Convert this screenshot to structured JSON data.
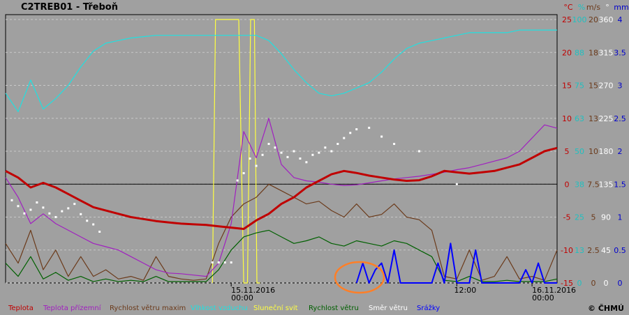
{
  "chart_data": {
    "type": "line",
    "title": "C2TREB01 - Třeboň",
    "copyright": "© ČHMÚ",
    "x_range_hours": [
      -36,
      52
    ],
    "x_ticks": [
      {
        "h": 0,
        "lines": [
          "15.11.2016",
          "00:00"
        ]
      },
      {
        "h": 36,
        "lines": [
          "12:00"
        ]
      },
      {
        "h": 48,
        "lines": [
          "16.11.2016",
          "00:00"
        ]
      }
    ],
    "axes": [
      {
        "unit": "°C",
        "color": "#c00000",
        "ticks": [
          "25",
          "20",
          "15",
          "10",
          "5",
          "0",
          "-5",
          "-10",
          "-15"
        ]
      },
      {
        "unit": "%",
        "color": "#20c0c0",
        "ticks": [
          "100",
          "88",
          "75",
          "63",
          "50",
          "38",
          "25",
          "13",
          "0"
        ]
      },
      {
        "unit": "m/s",
        "color": "#6b3a1a",
        "ticks": [
          "20",
          "18",
          "15",
          "13",
          "10",
          "7.5",
          "5",
          "2.5",
          "0"
        ]
      },
      {
        "unit": "°",
        "color": "#ffffff",
        "ticks": [
          "360",
          "315",
          "270",
          "225",
          "180",
          "135",
          "90",
          "45",
          "0"
        ]
      },
      {
        "unit": "mm",
        "color": "#0000cc",
        "ticks": [
          "4",
          "3.5",
          "3",
          "2.5",
          "2",
          "1.5",
          "1",
          "0.5",
          "0"
        ]
      }
    ],
    "series": [
      {
        "name": "Teplota",
        "color": "#c00000",
        "axis": "°C",
        "x": [
          -36,
          -34,
          -32,
          -30,
          -28,
          -26,
          -24,
          -22,
          -20,
          -18,
          -16,
          -14,
          -12,
          -10,
          -8,
          -6,
          -4,
          -2,
          0,
          2,
          4,
          6,
          8,
          10,
          12,
          14,
          16,
          18,
          20,
          22,
          24,
          26,
          28,
          30,
          32,
          34,
          36,
          38,
          40,
          42,
          44,
          46,
          48,
          50,
          52
        ],
        "y": [
          2,
          1,
          -0.5,
          0.2,
          -0.5,
          -1.5,
          -2.5,
          -3.5,
          -4,
          -4.5,
          -5,
          -5.3,
          -5.6,
          -5.8,
          -6,
          -6.1,
          -6.2,
          -6.4,
          -6.6,
          -6.8,
          -5.5,
          -4.5,
          -3,
          -2,
          -0.5,
          0.5,
          1.5,
          2,
          1.7,
          1.3,
          1,
          0.7,
          0.5,
          0.6,
          1.2,
          2,
          1.8,
          1.6,
          1.8,
          2,
          2.5,
          3,
          4,
          5,
          5.5
        ]
      },
      {
        "name": "Teplota přízemní",
        "color": "#a020c0",
        "axis": "°C",
        "x": [
          -36,
          -34,
          -32,
          -30,
          -28,
          -26,
          -24,
          -22,
          -20,
          -18,
          -16,
          -14,
          -12,
          -10,
          -8,
          -6,
          -4,
          -2,
          0,
          2,
          4,
          6,
          8,
          10,
          12,
          14,
          16,
          18,
          20,
          22,
          24,
          26,
          28,
          30,
          32,
          34,
          36,
          38,
          40,
          42,
          44,
          46,
          48,
          50,
          52
        ],
        "y": [
          1,
          -2,
          -6,
          -4.5,
          -6,
          -7,
          -8,
          -9,
          -9.5,
          -10,
          -11,
          -12,
          -13,
          -13.5,
          -13.6,
          -13.8,
          -14,
          -12,
          -6,
          8,
          4,
          10,
          3,
          1,
          0.5,
          0.3,
          0,
          -0.2,
          -0.1,
          0.2,
          0.5,
          0.8,
          1,
          1.2,
          1.5,
          1.8,
          2.2,
          2.5,
          3,
          3.5,
          4,
          5,
          7,
          9,
          8.5
        ]
      },
      {
        "name": "Rychlost větru maxim",
        "color": "#6b3a1a",
        "axis": "m/s",
        "x": [
          -36,
          -34,
          -32,
          -30,
          -28,
          -26,
          -24,
          -22,
          -20,
          -18,
          -16,
          -14,
          -12,
          -10,
          -8,
          -6,
          -4,
          -2,
          0,
          2,
          4,
          6,
          8,
          10,
          12,
          14,
          16,
          18,
          20,
          22,
          24,
          26,
          28,
          30,
          32,
          34,
          36,
          38,
          40,
          42,
          44,
          46,
          48,
          50,
          52
        ],
        "y": [
          3,
          1.5,
          4,
          1,
          2.5,
          0.5,
          2,
          0.5,
          1,
          0.3,
          0.5,
          0.2,
          2,
          0.5,
          0.3,
          0.2,
          0.3,
          3,
          5,
          6,
          6.5,
          7.5,
          7,
          6.5,
          6,
          6.2,
          5.5,
          5,
          6,
          5,
          5.2,
          6,
          5,
          4.8,
          4,
          0.5,
          0.3,
          2.5,
          0.2,
          0.5,
          2,
          0.3,
          0.5,
          0.2,
          2.5
        ]
      },
      {
        "name": "Vlhkost vzduchu",
        "color": "#20e0e0",
        "axis": "%",
        "x": [
          -36,
          -34,
          -32,
          -30,
          -28,
          -26,
          -24,
          -22,
          -20,
          -18,
          -16,
          -14,
          -12,
          -10,
          -8,
          -6,
          -4,
          -2,
          0,
          2,
          4,
          6,
          8,
          10,
          12,
          14,
          16,
          18,
          20,
          22,
          24,
          26,
          28,
          30,
          32,
          34,
          36,
          38,
          40,
          42,
          44,
          46,
          48,
          50,
          52
        ],
        "y": [
          72,
          65,
          77,
          66,
          70,
          75,
          82,
          88,
          91,
          92,
          93,
          93.5,
          94,
          94,
          94,
          94,
          94,
          94,
          94,
          94,
          94,
          92,
          87,
          81,
          76,
          72,
          71,
          72,
          74,
          76,
          80,
          85,
          89,
          91,
          92,
          93,
          94,
          95,
          95,
          95,
          95,
          96,
          96,
          96,
          96
        ]
      },
      {
        "name": "Sluneční svit",
        "color": "#ffff40",
        "axis": "%",
        "x": [
          -3,
          -2.5,
          -1.8,
          0.5,
          1.2,
          2,
          2.6,
          3.1,
          3.7,
          4.1,
          4.6
        ],
        "y": [
          0,
          100,
          100,
          100,
          100,
          0,
          0,
          100,
          100,
          0,
          0
        ]
      },
      {
        "name": "Rychlost větru",
        "color": "#006000",
        "axis": "m/s",
        "x": [
          -36,
          -34,
          -32,
          -30,
          -28,
          -26,
          -24,
          -22,
          -20,
          -18,
          -16,
          -14,
          -12,
          -10,
          -8,
          -6,
          -4,
          -2,
          0,
          2,
          4,
          6,
          8,
          10,
          12,
          14,
          16,
          18,
          20,
          22,
          24,
          26,
          28,
          30,
          32,
          34,
          36,
          38,
          40,
          42,
          44,
          46,
          48,
          50,
          52
        ],
        "y": [
          1.5,
          0.5,
          2,
          0.3,
          0.8,
          0.2,
          0.5,
          0.1,
          0.3,
          0.1,
          0.2,
          0.1,
          0.5,
          0.1,
          0.1,
          0.1,
          0.1,
          1,
          2.5,
          3.5,
          3.8,
          4,
          3.5,
          3,
          3.2,
          3.5,
          3,
          2.8,
          3.2,
          3,
          2.8,
          3.2,
          3,
          2.5,
          2,
          0.2,
          0.1,
          0.5,
          0.1,
          0.1,
          0.2,
          0.1,
          0.1,
          0.1,
          0.3
        ]
      },
      {
        "name": "Směr větru",
        "color": "#ffffff",
        "axis": "°",
        "x": [
          -35,
          -34,
          -33,
          -32,
          -31,
          -30,
          -29,
          -28,
          -27,
          -26,
          -25,
          -24,
          -23,
          -22,
          -21,
          -3,
          -2,
          -1,
          0,
          1,
          2,
          3,
          4,
          5,
          6,
          7,
          8,
          9,
          10,
          11,
          12,
          13,
          14,
          15,
          16,
          17,
          18,
          19,
          20,
          22,
          24,
          26,
          30,
          36
        ],
        "y": [
          113,
          105,
          95,
          100,
          110,
          103,
          95,
          90,
          98,
          102,
          108,
          94,
          85,
          80,
          70,
          28,
          28,
          28,
          28,
          140,
          150,
          170,
          160,
          175,
          190,
          185,
          178,
          172,
          180,
          170,
          165,
          175,
          178,
          185,
          180,
          190,
          198,
          205,
          210,
          212,
          200,
          190,
          180,
          135
        ]
      },
      {
        "name": "Srážky",
        "color": "#0000ff",
        "axis": "mm",
        "x": [
          20,
          21,
          22,
          23,
          24,
          25,
          26,
          27,
          28,
          29,
          30,
          31,
          32,
          33,
          34,
          35,
          36,
          37,
          38,
          39,
          40,
          41,
          42,
          43,
          44,
          45,
          46,
          47,
          48,
          49,
          50,
          51,
          52
        ],
        "y": [
          0,
          0.3,
          0,
          0.2,
          0.3,
          0,
          0.5,
          0,
          0,
          0,
          0,
          0,
          0,
          0.3,
          0,
          0.6,
          0,
          0,
          0,
          0.5,
          0,
          0,
          0,
          0,
          0,
          0,
          0,
          0.2,
          0,
          0.3,
          0,
          0,
          0
        ]
      }
    ]
  }
}
